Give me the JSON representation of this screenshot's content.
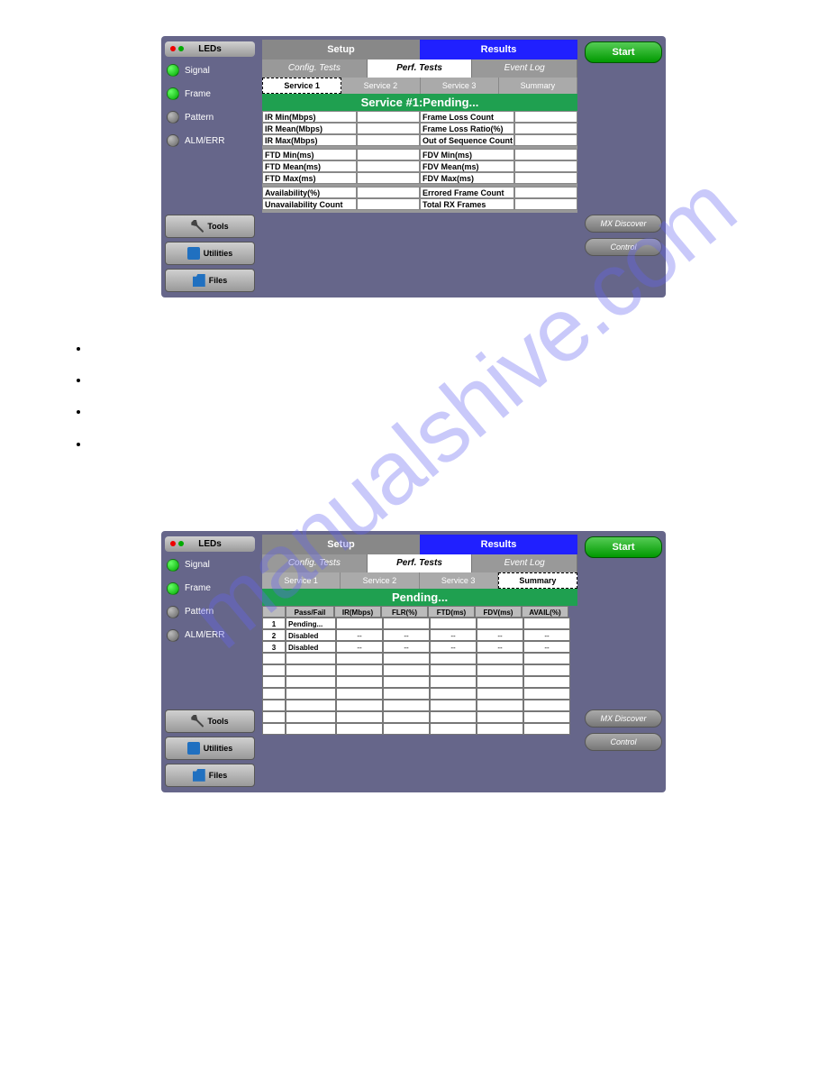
{
  "watermark": "manualshive.com",
  "sidebar": {
    "leds_label": "LEDs",
    "items": [
      {
        "label": "Signal",
        "color": "green"
      },
      {
        "label": "Frame",
        "color": "green"
      },
      {
        "label": "Pattern",
        "color": "gray"
      },
      {
        "label": "ALM/ERR",
        "color": "gray"
      }
    ],
    "tools_label": "Tools",
    "utilities_label": "Utilities",
    "files_label": "Files"
  },
  "top_tabs": {
    "setup": "Setup",
    "results": "Results"
  },
  "sub_tabs": {
    "config": "Config. Tests",
    "perf": "Perf. Tests",
    "event": "Event Log"
  },
  "svc_tabs": {
    "s1": "Service 1",
    "s2": "Service 2",
    "s3": "Service 3",
    "summary": "Summary"
  },
  "right": {
    "start": "Start",
    "mx": "MX Discover",
    "control": "Control"
  },
  "screen1": {
    "banner": "Service #1:Pending...",
    "groups": [
      {
        "left": [
          "IR Min(Mbps)",
          "IR Mean(Mbps)",
          "IR Max(Mbps)"
        ],
        "right": [
          "Frame Loss Count",
          "Frame Loss Ratio(%)",
          "Out of Sequence Count"
        ]
      },
      {
        "left": [
          "FTD Min(ms)",
          "FTD Mean(ms)",
          "FTD Max(ms)"
        ],
        "right": [
          "FDV Min(ms)",
          "FDV Mean(ms)",
          "FDV Max(ms)"
        ]
      },
      {
        "left": [
          "Availability(%)",
          "Unavailability Count"
        ],
        "right": [
          "Errored Frame Count",
          "Total RX Frames"
        ]
      }
    ]
  },
  "screen2": {
    "banner": "Pending...",
    "headers": [
      "",
      "Pass/Fail",
      "IR(Mbps)",
      "FLR(%)",
      "FTD(ms)",
      "FDV(ms)",
      "AVAIL(%)"
    ],
    "rows": [
      {
        "idx": "1",
        "pf": "Pending...",
        "cells": [
          "",
          "",
          "",
          "",
          ""
        ]
      },
      {
        "idx": "2",
        "pf": "Disabled",
        "cells": [
          "--",
          "--",
          "--",
          "--",
          "--"
        ]
      },
      {
        "idx": "3",
        "pf": "Disabled",
        "cells": [
          "--",
          "--",
          "--",
          "--",
          "--"
        ]
      },
      {
        "idx": "",
        "pf": "",
        "cells": [
          "",
          "",
          "",
          "",
          ""
        ]
      },
      {
        "idx": "",
        "pf": "",
        "cells": [
          "",
          "",
          "",
          "",
          ""
        ]
      },
      {
        "idx": "",
        "pf": "",
        "cells": [
          "",
          "",
          "",
          "",
          ""
        ]
      },
      {
        "idx": "",
        "pf": "",
        "cells": [
          "",
          "",
          "",
          "",
          ""
        ]
      },
      {
        "idx": "",
        "pf": "",
        "cells": [
          "",
          "",
          "",
          "",
          ""
        ]
      },
      {
        "idx": "",
        "pf": "",
        "cells": [
          "",
          "",
          "",
          "",
          ""
        ]
      },
      {
        "idx": "",
        "pf": "",
        "cells": [
          "",
          "",
          "",
          "",
          ""
        ]
      }
    ]
  }
}
